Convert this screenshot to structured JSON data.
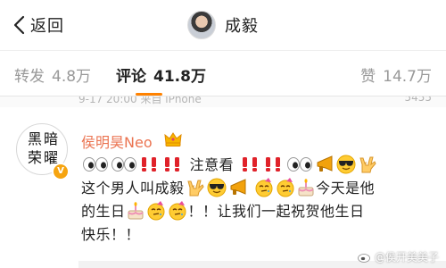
{
  "nav": {
    "back_label": "返回",
    "title": "成毅"
  },
  "stats": {
    "repost_label": "转发",
    "repost_count": "4.8万",
    "comment_label": "评论",
    "comment_count": "41.8万",
    "like_label": "赞",
    "like_count": "14.7万",
    "active_tab": "comment",
    "accent_color": "#ff8200"
  },
  "meta": {
    "time_text": "9-17 20:00 来自 iPhone",
    "count_text": "5455"
  },
  "comment": {
    "author": "侯明昊Neo",
    "author_color": "#eb7350",
    "author_badge_icon": "crown-badge-icon",
    "avatar_text": "黑暗荣曜",
    "verified_icon": "verified-v-icon",
    "text_segments": [
      "注意看",
      "这个男人叫成毅",
      "今天是他",
      "的生日",
      "！！让我们一起祝贺他生日",
      "快乐！！"
    ],
    "emojis": {
      "eyes": "eyes-emoji-icon",
      "double_exclamation": "double-exclamation-emoji-icon",
      "love_you_gesture": "love-you-gesture-emoji-icon",
      "cool_face": "sunglasses-emoji-icon",
      "megaphone": "megaphone-emoji-icon",
      "party_face": "party-face-emoji-icon",
      "cake": "birthday-cake-emoji-icon"
    }
  },
  "watermark": {
    "text": "@侯开美美子"
  }
}
